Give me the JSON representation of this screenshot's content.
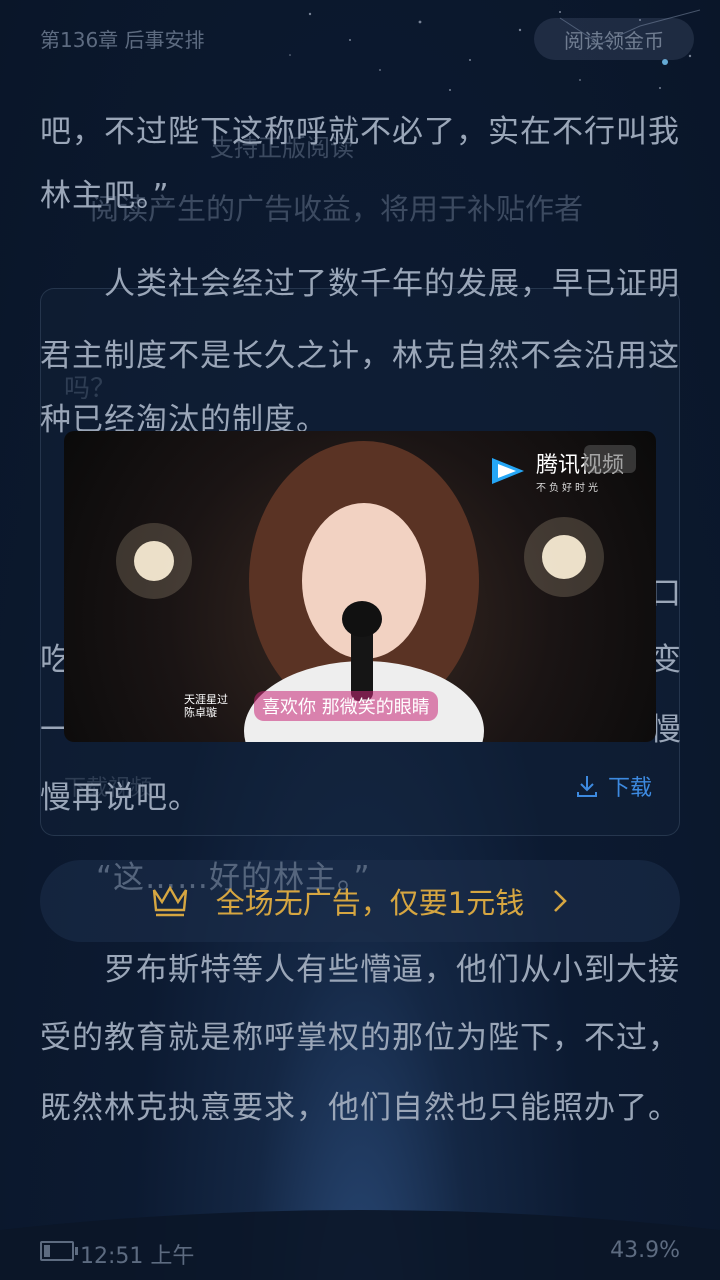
{
  "header": {
    "chapter": "第136章 后事安排",
    "coin_button": "阅读领金币"
  },
  "content": {
    "lines": [
      "吧，不过陛下这称呼就不必了，实在不行叫我",
      "林主吧。”",
      "　　人类社会经过了数千年的发展，早已证明",
      "君主制度不是长久之计，林克自然不会沿用这",
      "种已经淘汰的制度。",
      "“这……好的林主。”",
      "　　罗布斯特等人有些懵逼，他们从小到大接",
      "受的教育就是称呼掌权的那位为陛下，不过，",
      "既然林克执意要求，他们自然也只能照办了。"
    ],
    "partial_left": [
      "吃",
      "一",
      "慢再说吧。"
    ],
    "partial_right": [
      "口",
      "变",
      "慢"
    ]
  },
  "ghost": {
    "line1": "支持正版阅读",
    "line2": "阅读产生的广告收益，将用于补贴作者",
    "line3": "吗？",
    "line4": "下载视频"
  },
  "ad": {
    "brand": "腾讯视频",
    "brand_slogan": "不负好时光",
    "caption": "喜欢你 那微笑的眼睛",
    "caption_tag": "天涯星过",
    "caption_name": "陈卓璇",
    "download_label": "下载"
  },
  "banner": {
    "text": "全场无广告，仅要1元钱"
  },
  "footer": {
    "time": "12:51 上午",
    "progress": "43.9%"
  },
  "colors": {
    "accent_gold": "#d6a641",
    "download_blue": "#3d8ae0",
    "text": "#9aa6b8"
  }
}
